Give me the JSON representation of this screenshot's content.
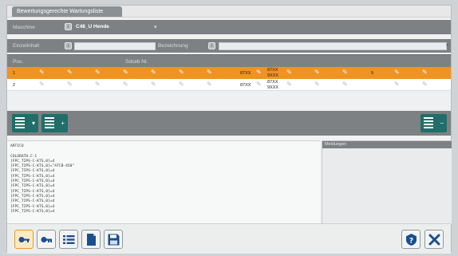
{
  "tab": {
    "label": "Bewertungsgerechte Wartungsliste"
  },
  "machine": {
    "label": "Maschine",
    "badge": "i",
    "value": "C48_U Hende"
  },
  "unit": {
    "label": "Einzelinhalt",
    "badge": "i"
  },
  "designation": {
    "label": "Bezeichnung",
    "badge": "i"
  },
  "grid": {
    "columns": [
      "Pos.",
      "Sdceb Nr."
    ],
    "rows": [
      {
        "pos": "1",
        "code": "87XX",
        "ref": [
          "87XX",
          "9XXX"
        ],
        "end": "9",
        "selected": true
      },
      {
        "pos": "2",
        "code": "87XX",
        "ref": [
          "87XX",
          "9XXX"
        ],
        "end": "",
        "selected": false
      }
    ]
  },
  "code": {
    "lines": [
      "ARTICO",
      "",
      "COLORATH.C-1",
      "[FPC_TIPS-C-KTS,0]=4",
      "[FPC_TIPS-C-KTS,0]=\"ATCB-450\"",
      "[FPC_TIPS-C-KTS,0]=4",
      "[FPC_TIPS-C-KTS,0]=4",
      "[FPC_TIPS-C-KTS,0]=4",
      "[FPC_TIPS-C-KTS,0]=4",
      "[FPC_TIPS-C-KTS,0]=4",
      "[FPC_TIPS-C-KTS,0]=4",
      "[FPC_TIPS-C-KTS,0]=4",
      "[FPC_TIPS-C-KTS,0]=4",
      "[FPC_TIPS-C-KTS,0]=4"
    ]
  },
  "messages": {
    "header": "Meldungen"
  },
  "colors": {
    "accent": "#f0931f",
    "teal": "#1f6e6a",
    "blue": "#1a4f8f"
  },
  "icons": [
    "key-icon",
    "key-alt-icon",
    "list-icon",
    "document-icon",
    "save-icon",
    "help-icon",
    "close-icon"
  ]
}
